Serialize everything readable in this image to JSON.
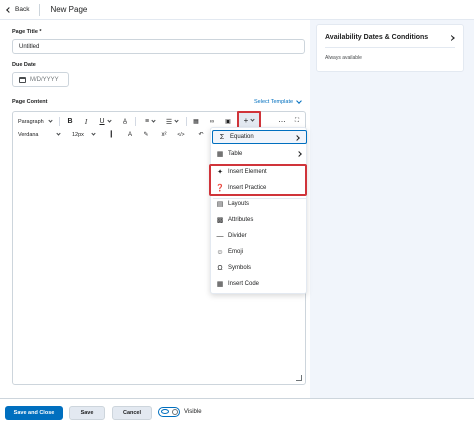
{
  "header": {
    "back_label": "Back",
    "page_name": "New Page"
  },
  "form": {
    "title_label": "Page Title *",
    "title_value": "Untitled",
    "due_label": "Due Date",
    "due_placeholder": "M/D/YYYY",
    "content_label": "Page Content",
    "select_template_label": "Select Template"
  },
  "toolbar": {
    "paragraph": "Paragraph",
    "font": "Verdana",
    "size": "12px"
  },
  "insert_menu": {
    "items": [
      {
        "label": "Equation",
        "icon": "sigma-icon"
      },
      {
        "label": "Table",
        "icon": "table-icon"
      },
      {
        "label": "Insert Element",
        "icon": "element-icon"
      },
      {
        "label": "Insert Practice",
        "icon": "question-icon"
      },
      {
        "label": "Layouts",
        "icon": "layout-icon"
      },
      {
        "label": "Attributes",
        "icon": "attributes-icon"
      },
      {
        "label": "Divider",
        "icon": "divider-icon"
      },
      {
        "label": "Emoji",
        "icon": "emoji-icon"
      },
      {
        "label": "Symbols",
        "icon": "omega-icon"
      },
      {
        "label": "Insert Code",
        "icon": "code-icon"
      }
    ]
  },
  "sidebar": {
    "availability_title": "Availability Dates & Conditions",
    "availability_sub": "Always available"
  },
  "footer": {
    "save_close": "Save and Close",
    "save": "Save",
    "cancel": "Cancel",
    "visible": "Visible"
  },
  "colors": {
    "primary": "#006fbf",
    "highlight": "#d0343a",
    "panel_bg": "#f1f5fb"
  }
}
